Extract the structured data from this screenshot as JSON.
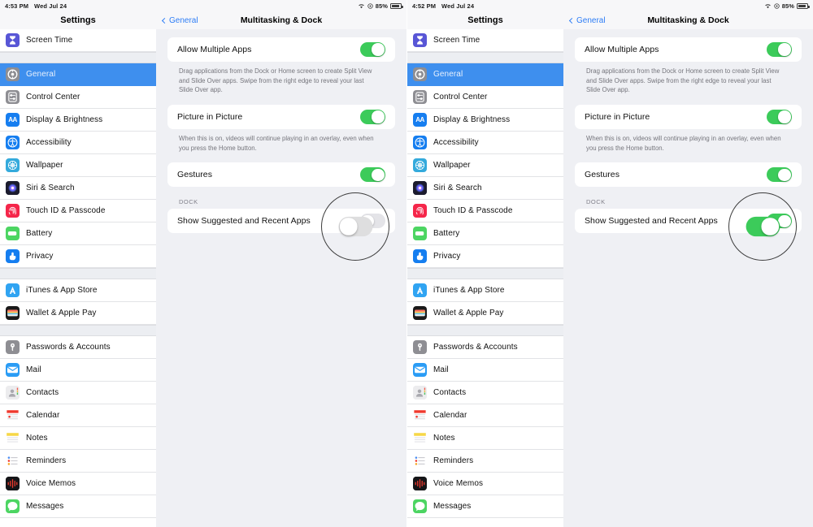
{
  "screens": [
    {
      "id": "before",
      "statusbar": {
        "time": "4:53 PM",
        "date": "Wed Jul 24",
        "battery_pct": "85%",
        "wifi_icon": "wifi-icon",
        "location_icon": "location-icon",
        "battery_icon": "battery-icon"
      },
      "sidebar_title": "Settings",
      "nav": {
        "back_label": "General",
        "title": "Multitasking & Dock"
      },
      "rows": [
        {
          "label": "Allow Multiple Apps",
          "toggle": "on"
        },
        {
          "label": "Picture in Picture",
          "toggle": "on"
        },
        {
          "label": "Gestures",
          "toggle": "on"
        }
      ],
      "footnotes": [
        "Drag applications from the Dock or Home screen to create Split View and Slide Over apps. Swipe from the right edge to reveal your last Slide Over app.",
        "When this is on, videos will continue playing in an overlay, even when you press the Home button."
      ],
      "dock_group_label": "DOCK",
      "dock_row": {
        "label": "Show Suggested and Recent Apps",
        "toggle": "off"
      }
    },
    {
      "id": "after",
      "statusbar": {
        "time": "4:52 PM",
        "date": "Wed Jul 24",
        "battery_pct": "85%",
        "wifi_icon": "wifi-icon",
        "location_icon": "location-icon",
        "battery_icon": "battery-icon"
      },
      "sidebar_title": "Settings",
      "nav": {
        "back_label": "General",
        "title": "Multitasking & Dock"
      },
      "rows": [
        {
          "label": "Allow Multiple Apps",
          "toggle": "on"
        },
        {
          "label": "Picture in Picture",
          "toggle": "on"
        },
        {
          "label": "Gestures",
          "toggle": "on"
        }
      ],
      "footnotes": [
        "Drag applications from the Dock or Home screen to create Split View and Slide Over apps. Swipe from the right edge to reveal your last Slide Over app.",
        "When this is on, videos will continue playing in an overlay, even when you press the Home button."
      ],
      "dock_group_label": "DOCK",
      "dock_row": {
        "label": "Show Suggested and Recent Apps",
        "toggle": "on"
      }
    }
  ],
  "sidebar_groups": [
    {
      "items": [
        {
          "label": "Screen Time",
          "icon": "screentime-icon",
          "selected": false
        }
      ]
    },
    {
      "items": [
        {
          "label": "General",
          "icon": "general-icon",
          "selected": true
        },
        {
          "label": "Control Center",
          "icon": "control-center-icon",
          "selected": false
        },
        {
          "label": "Display & Brightness",
          "icon": "display-brightness-icon",
          "selected": false
        },
        {
          "label": "Accessibility",
          "icon": "accessibility-icon",
          "selected": false
        },
        {
          "label": "Wallpaper",
          "icon": "wallpaper-icon",
          "selected": false
        },
        {
          "label": "Siri & Search",
          "icon": "siri-search-icon",
          "selected": false
        },
        {
          "label": "Touch ID & Passcode",
          "icon": "touch-id-icon",
          "selected": false
        },
        {
          "label": "Battery",
          "icon": "battery-icon",
          "selected": false
        },
        {
          "label": "Privacy",
          "icon": "privacy-icon",
          "selected": false
        }
      ]
    },
    {
      "items": [
        {
          "label": "iTunes & App Store",
          "icon": "itunes-app-store-icon",
          "selected": false
        },
        {
          "label": "Wallet & Apple Pay",
          "icon": "wallet-icon",
          "selected": false
        }
      ]
    },
    {
      "items": [
        {
          "label": "Passwords & Accounts",
          "icon": "passwords-icon",
          "selected": false
        },
        {
          "label": "Mail",
          "icon": "mail-icon",
          "selected": false
        },
        {
          "label": "Contacts",
          "icon": "contacts-icon",
          "selected": false
        },
        {
          "label": "Calendar",
          "icon": "calendar-icon",
          "selected": false
        },
        {
          "label": "Notes",
          "icon": "notes-icon",
          "selected": false
        },
        {
          "label": "Reminders",
          "icon": "reminders-icon",
          "selected": false
        },
        {
          "label": "Voice Memos",
          "icon": "voice-memos-icon",
          "selected": false
        },
        {
          "label": "Messages",
          "icon": "messages-icon",
          "selected": false
        }
      ]
    }
  ],
  "colors": {
    "accent_blue": "#3e8fee",
    "link_blue": "#2d7df6",
    "toggle_on_green": "#3ccb5a",
    "toggle_off_gray": "#e4e4e8",
    "pane_background": "#eff0f4",
    "callout_ring": "#3c3c3c"
  }
}
